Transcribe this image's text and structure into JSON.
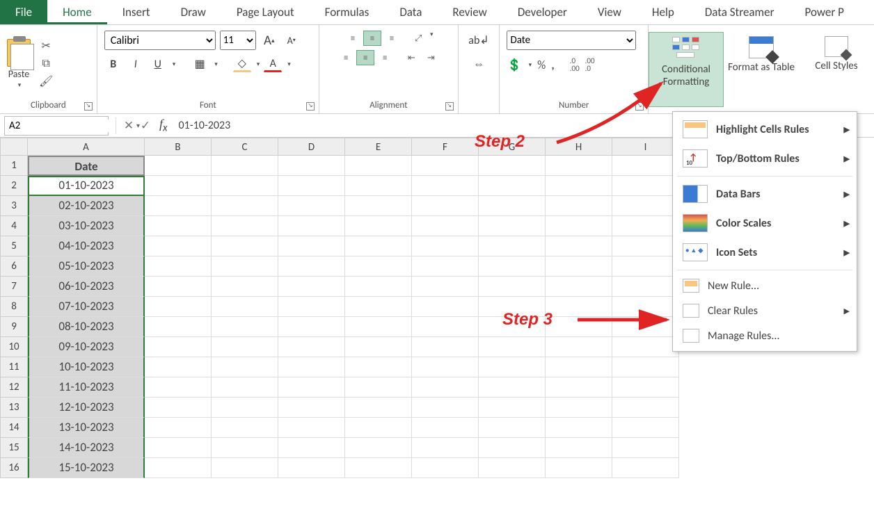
{
  "tabs": {
    "file": "File",
    "home": "Home",
    "insert": "Insert",
    "draw": "Draw",
    "page_layout": "Page Layout",
    "formulas": "Formulas",
    "data": "Data",
    "review": "Review",
    "developer": "Developer",
    "view": "View",
    "help": "Help",
    "data_streamer": "Data Streamer",
    "power": "Power P"
  },
  "ribbon": {
    "clipboard": {
      "paste": "Paste",
      "label": "Clipboard"
    },
    "font": {
      "name": "Calibri",
      "size": "11",
      "label": "Font",
      "bold": "B",
      "italic": "I",
      "underline": "U",
      "a_big": "A",
      "a_small": "A"
    },
    "alignment": {
      "label": "Alignment"
    },
    "number": {
      "format": "Date",
      "label": "Number",
      "percent": "%",
      "comma": ",",
      "inc": ".0 .00",
      "dec": ".00 .0"
    },
    "styles": {
      "cf": "Conditional Formatting",
      "cf_caret": "⌄",
      "fat": "Format as Table",
      "fat_caret": "⌄",
      "cs": "Cell Styles",
      "cs_caret": "⌄"
    }
  },
  "cf_menu": {
    "highlight": "Highlight Cells Rules",
    "topbottom": "Top/Bottom Rules",
    "databars": "Data Bars",
    "colorscales": "Color Scales",
    "iconsets": "Icon Sets",
    "newrule": "New Rule...",
    "clear": "Clear Rules",
    "manage": "Manage Rules..."
  },
  "formula_bar": {
    "name": "A2",
    "value": "01-10-2023"
  },
  "columns": [
    "A",
    "B",
    "C",
    "D",
    "E",
    "F",
    "G",
    "H",
    "I"
  ],
  "rows": [
    1,
    2,
    3,
    4,
    5,
    6,
    7,
    8,
    9,
    10,
    11,
    12,
    13,
    14,
    15,
    16
  ],
  "data": {
    "header": "Date",
    "values": [
      "01-10-2023",
      "02-10-2023",
      "03-10-2023",
      "04-10-2023",
      "05-10-2023",
      "06-10-2023",
      "07-10-2023",
      "08-10-2023",
      "09-10-2023",
      "10-10-2023",
      "11-10-2023",
      "12-10-2023",
      "13-10-2023",
      "14-10-2023",
      "15-10-2023"
    ]
  },
  "annotations": {
    "step2": "Step 2",
    "step3": "Step 3"
  }
}
